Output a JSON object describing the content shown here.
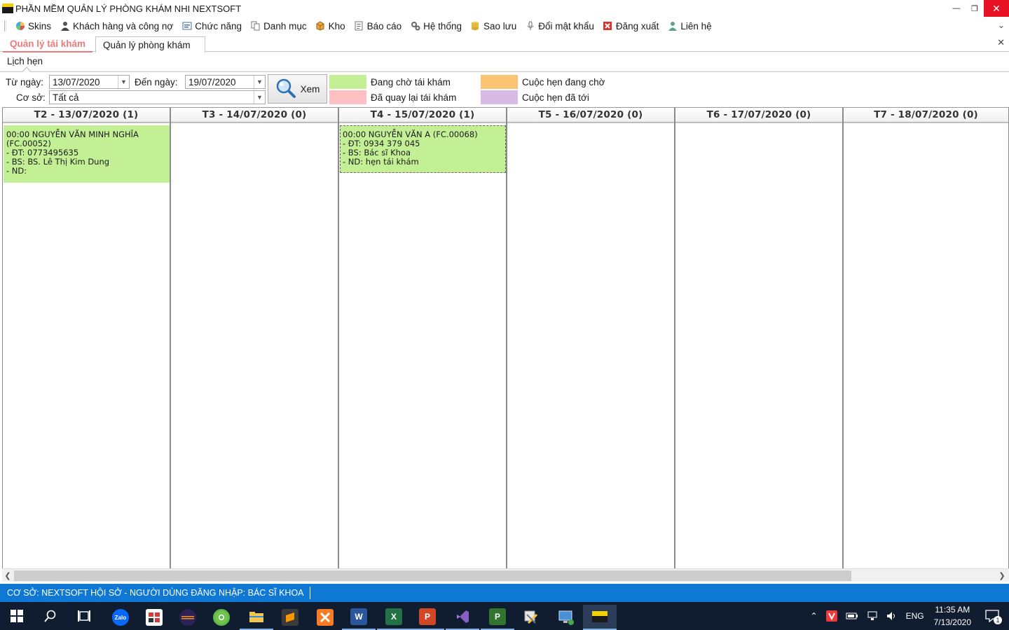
{
  "window": {
    "title": "PHẦN MỀM QUẢN LÝ PHÒNG KHÁM NHI NEXTSOFT"
  },
  "menu": [
    {
      "label": "Skins",
      "icon": "skins-icon"
    },
    {
      "label": "Khách hàng và công nợ",
      "icon": "customer-icon"
    },
    {
      "label": "Chức năng",
      "icon": "function-icon"
    },
    {
      "label": "Danh mục",
      "icon": "catalog-icon"
    },
    {
      "label": "Kho",
      "icon": "warehouse-icon"
    },
    {
      "label": "Báo cáo",
      "icon": "report-icon"
    },
    {
      "label": "Hệ thống",
      "icon": "system-icon"
    },
    {
      "label": "Sao lưu",
      "icon": "backup-icon"
    },
    {
      "label": "Đổi mật khẩu",
      "icon": "password-icon"
    },
    {
      "label": "Đăng xuất",
      "icon": "logout-icon"
    },
    {
      "label": "Liên hệ",
      "icon": "contact-icon"
    }
  ],
  "tabs": [
    {
      "label": "Quản lý tái khám",
      "active": true
    },
    {
      "label": "Quản lý phòng khám",
      "active": false
    }
  ],
  "group": {
    "title": "Lịch hẹn"
  },
  "filters": {
    "from_label": "Từ ngày:",
    "from_value": "13/07/2020",
    "to_label": "Đến ngày:",
    "to_value": "19/07/2020",
    "branch_label": "Cơ sở:",
    "branch_value": "Tất cả",
    "view_button": "Xem"
  },
  "legend": [
    {
      "label": "Đang chờ tái khám",
      "color": "#c4f095"
    },
    {
      "label": "Đã quay lại tái khám",
      "color": "#ffc0c4"
    },
    {
      "label": "Cuộc hẹn đang chờ",
      "color": "#fbc474"
    },
    {
      "label": "Cuộc hẹn đã tới",
      "color": "#d9b9e6"
    }
  ],
  "calendar": {
    "days": [
      {
        "header": "T2 - 13/07/2020 (1)"
      },
      {
        "header": "T3 - 14/07/2020 (0)"
      },
      {
        "header": "T4 - 15/07/2020 (1)"
      },
      {
        "header": "T5 - 16/07/2020 (0)"
      },
      {
        "header": "T6 - 17/07/2020 (0)"
      },
      {
        "header": "T7 - 18/07/2020 (0)"
      }
    ],
    "appointments": [
      {
        "line1": "00:00 NGUYỄN VĂN MINH NGHĨA",
        "line2": "(FC.00052)",
        "phone": "- ĐT: 0773495635",
        "doctor": "- BS: BS. Lê Thị Kim Dung",
        "note": "- ND:"
      },
      {
        "line1": "00:00 NGUYỄN VĂN A (FC.00068)",
        "phone": "- ĐT: 0934 379 045",
        "doctor": "- BS: Bác sĩ Khoa",
        "note": "- ND: hẹn tái khám"
      }
    ]
  },
  "status": {
    "text": "CƠ SỞ: NEXTSOFT HỘI SỞ - NGƯỜI DÙNG ĐĂNG NHẬP: BÁC SĨ KHOA"
  },
  "taskbar": {
    "apps": [
      {
        "name": "start-icon"
      },
      {
        "name": "search-icon"
      },
      {
        "name": "task-view-icon"
      },
      {
        "name": "zalo-icon",
        "label": "Zalo"
      },
      {
        "name": "ultraviewer-icon"
      },
      {
        "name": "eclipse-icon"
      },
      {
        "name": "chrome-icon"
      },
      {
        "name": "file-explorer-icon"
      },
      {
        "name": "sublime-icon"
      },
      {
        "name": "xampp-icon"
      },
      {
        "name": "word-icon"
      },
      {
        "name": "excel-icon"
      },
      {
        "name": "powerpoint-icon"
      },
      {
        "name": "visual-studio-icon"
      },
      {
        "name": "project-icon"
      },
      {
        "name": "tools-icon"
      },
      {
        "name": "remote-desktop-icon"
      },
      {
        "name": "nextsoft-app-icon"
      }
    ],
    "tray": {
      "language": "ENG",
      "time": "11:35 AM",
      "date": "7/13/2020",
      "notifications": "1"
    }
  }
}
